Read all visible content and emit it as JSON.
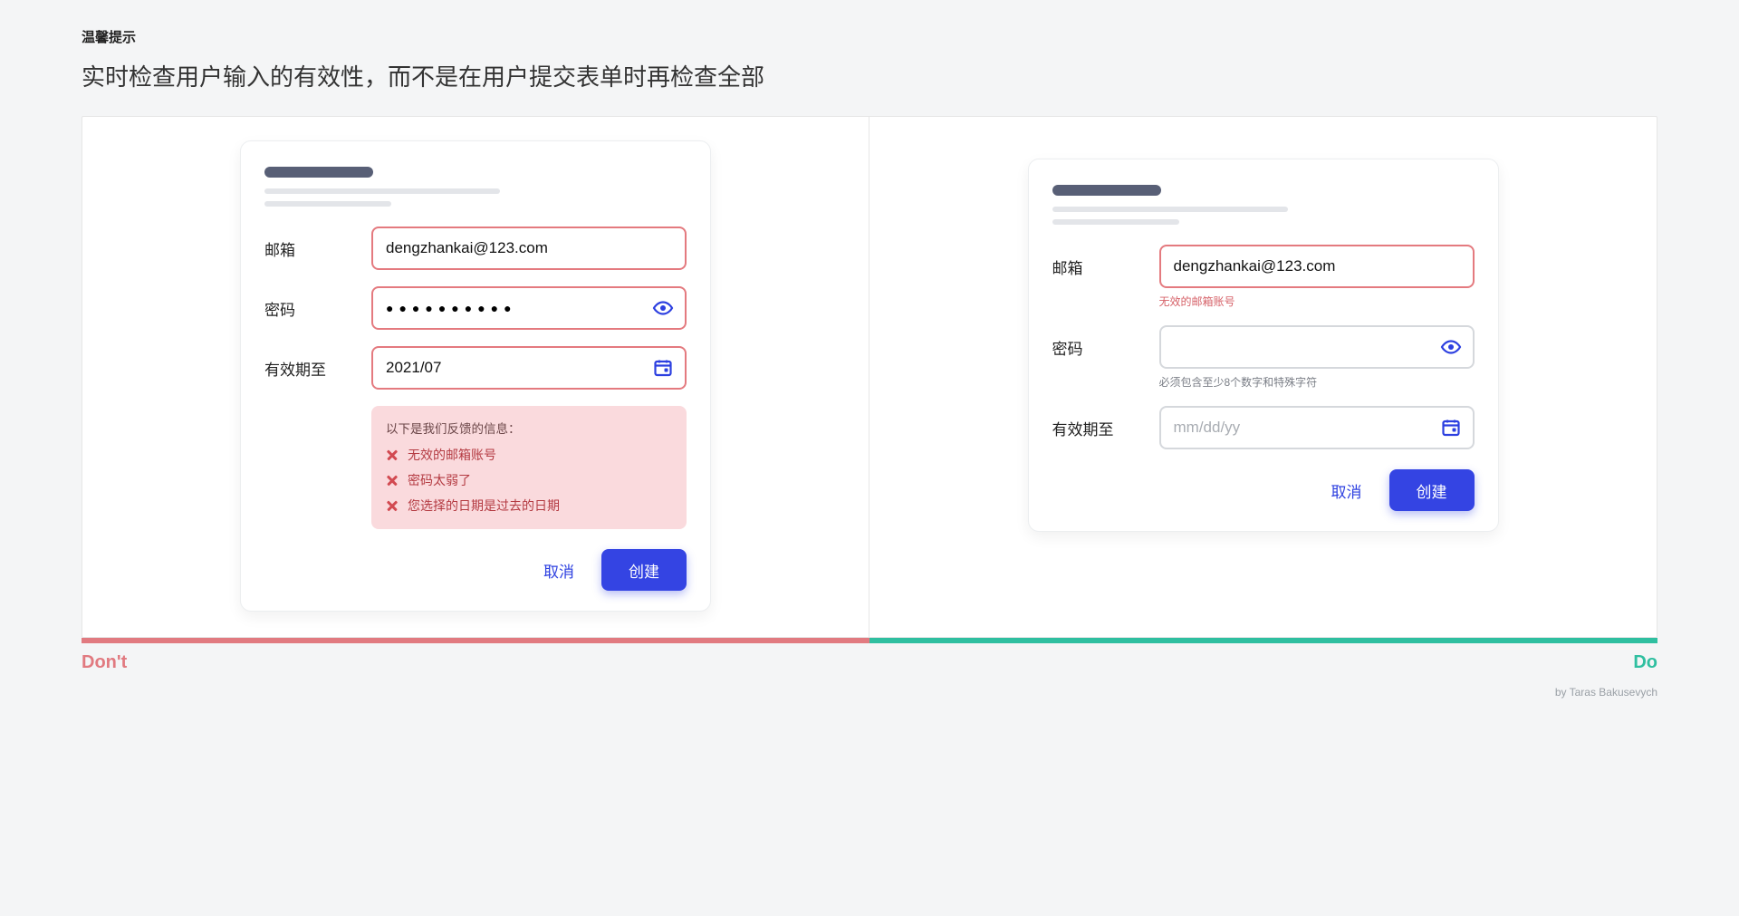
{
  "tipLabel": "温馨提示",
  "headline": "实时检查用户输入的有效性，而不是在用户提交表单时再检查全部",
  "labels": {
    "email": "邮箱",
    "password": "密码",
    "validUntil": "有效期至",
    "cancel": "取消",
    "create": "创建",
    "dont": "Don't",
    "do": "Do"
  },
  "left": {
    "email": "dengzhankai@123.com",
    "passwordDots": "●●●●●●●●●●",
    "date": "2021/07",
    "errorsTitle": "以下是我们反馈的信息：",
    "errors": [
      "无效的邮箱账号",
      "密码太弱了",
      "您选择的日期是过去的日期"
    ]
  },
  "right": {
    "email": "dengzhankai@123.com",
    "emailError": "无效的邮箱账号",
    "passwordHint": "必须包含至少8个数字和特殊字符",
    "datePlaceholder": "mm/dd/yy"
  },
  "credit": "by Taras Bakusevych"
}
